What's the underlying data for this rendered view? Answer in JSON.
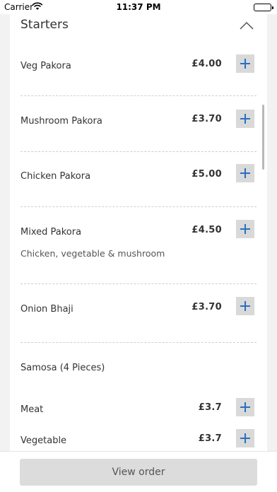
{
  "status_bar": {
    "carrier": "Carrier",
    "time": "11:37 PM"
  },
  "section": {
    "title": "Starters"
  },
  "items": [
    {
      "name": "Veg Pakora",
      "price": "£4.00"
    },
    {
      "name": "Mushroom Pakora",
      "price": "£3.70"
    },
    {
      "name": "Chicken Pakora",
      "price": "£5.00"
    },
    {
      "name": "Mixed Pakora",
      "price": "£4.50",
      "description": "Chicken, vegetable & mushroom"
    },
    {
      "name": "Onion Bhaji",
      "price": "£3.70"
    }
  ],
  "samosa": {
    "title": "Samosa (4 Pieces)",
    "options": [
      {
        "name": "Meat",
        "price": "£3.7"
      },
      {
        "name": "Vegetable",
        "price": "£3.7"
      }
    ]
  },
  "footer": {
    "view_order_label": "View order"
  },
  "colors": {
    "accent": "#2a6fc2",
    "button_bg": "#d9d9d9"
  }
}
